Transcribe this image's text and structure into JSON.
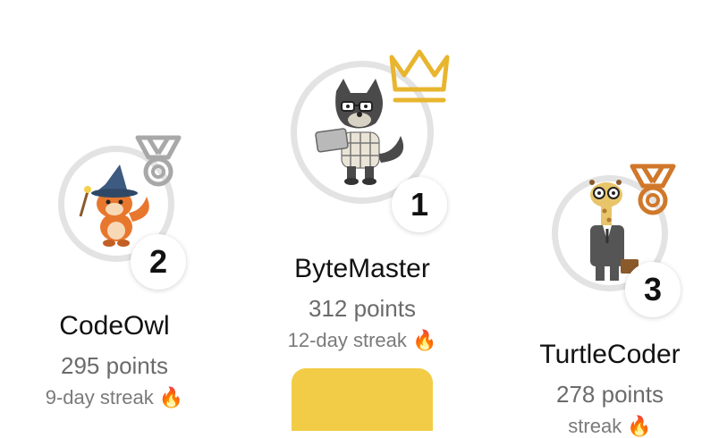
{
  "players": [
    {
      "rank": "2",
      "name": "CodeOwl",
      "points": "295 points",
      "streak": "9-day streak 🔥",
      "avatar": "fox-wizard-avatar",
      "award": "silver-medal-icon"
    },
    {
      "rank": "1",
      "name": "ByteMaster",
      "points": "312 points",
      "streak": "12-day streak 🔥",
      "avatar": "wolf-coder-avatar",
      "award": "crown-icon"
    },
    {
      "rank": "3",
      "name": "TurtleCoder",
      "points": "278 points",
      "streak": "streak 🔥",
      "avatar": "giraffe-businessman-avatar",
      "award": "bronze-medal-icon"
    }
  ],
  "colors": {
    "gold": "#e8b52f",
    "silver": "#a8a8a8",
    "bronze": "#d0782a",
    "podium": "#f2cc47"
  }
}
